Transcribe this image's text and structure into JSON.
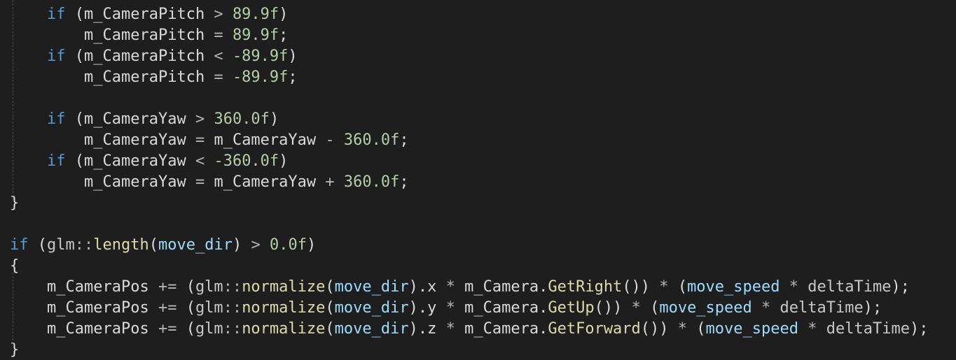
{
  "colors": {
    "background": "#1e1e1e",
    "keyword": "#569cd6",
    "member_variable": "#dadada",
    "number": "#b5cea8",
    "parameter": "#9cdcfe",
    "function": "#dcdcaa",
    "namespace": "#c8c8c8",
    "operator": "#b4b4b4",
    "punctuation": "#dcdcdc",
    "local_variable": "#c8c8c8",
    "indent_guide": "#4a4a4a"
  },
  "lines": [
    {
      "indent": 1,
      "tokens": [
        {
          "t": "if",
          "k": "keyword"
        },
        {
          "t": " (",
          "k": "punctuation"
        },
        {
          "t": "m_CameraPitch",
          "k": "member_variable"
        },
        {
          "t": " > ",
          "k": "operator"
        },
        {
          "t": "89.9f",
          "k": "number"
        },
        {
          "t": ")",
          "k": "punctuation"
        }
      ]
    },
    {
      "indent": 2,
      "tokens": [
        {
          "t": "m_CameraPitch",
          "k": "member_variable"
        },
        {
          "t": " = ",
          "k": "operator"
        },
        {
          "t": "89.9f",
          "k": "number"
        },
        {
          "t": ";",
          "k": "punctuation"
        }
      ]
    },
    {
      "indent": 1,
      "tokens": [
        {
          "t": "if",
          "k": "keyword"
        },
        {
          "t": " (",
          "k": "punctuation"
        },
        {
          "t": "m_CameraPitch",
          "k": "member_variable"
        },
        {
          "t": " < ",
          "k": "operator"
        },
        {
          "t": "-89.9f",
          "k": "number"
        },
        {
          "t": ")",
          "k": "punctuation"
        }
      ]
    },
    {
      "indent": 2,
      "tokens": [
        {
          "t": "m_CameraPitch",
          "k": "member_variable"
        },
        {
          "t": " = ",
          "k": "operator"
        },
        {
          "t": "-89.9f",
          "k": "number"
        },
        {
          "t": ";",
          "k": "punctuation"
        }
      ]
    },
    {
      "indent": 0,
      "tokens": []
    },
    {
      "indent": 1,
      "tokens": [
        {
          "t": "if",
          "k": "keyword"
        },
        {
          "t": " (",
          "k": "punctuation"
        },
        {
          "t": "m_CameraYaw",
          "k": "member_variable"
        },
        {
          "t": " > ",
          "k": "operator"
        },
        {
          "t": "360.0f",
          "k": "number"
        },
        {
          "t": ")",
          "k": "punctuation"
        }
      ]
    },
    {
      "indent": 2,
      "tokens": [
        {
          "t": "m_CameraYaw",
          "k": "member_variable"
        },
        {
          "t": " = ",
          "k": "operator"
        },
        {
          "t": "m_CameraYaw",
          "k": "member_variable"
        },
        {
          "t": " - ",
          "k": "operator"
        },
        {
          "t": "360.0f",
          "k": "number"
        },
        {
          "t": ";",
          "k": "punctuation"
        }
      ]
    },
    {
      "indent": 1,
      "tokens": [
        {
          "t": "if",
          "k": "keyword"
        },
        {
          "t": " (",
          "k": "punctuation"
        },
        {
          "t": "m_CameraYaw",
          "k": "member_variable"
        },
        {
          "t": " < ",
          "k": "operator"
        },
        {
          "t": "-360.0f",
          "k": "number"
        },
        {
          "t": ")",
          "k": "punctuation"
        }
      ]
    },
    {
      "indent": 2,
      "tokens": [
        {
          "t": "m_CameraYaw",
          "k": "member_variable"
        },
        {
          "t": " = ",
          "k": "operator"
        },
        {
          "t": "m_CameraYaw",
          "k": "member_variable"
        },
        {
          "t": " + ",
          "k": "operator"
        },
        {
          "t": "360.0f",
          "k": "number"
        },
        {
          "t": ";",
          "k": "punctuation"
        }
      ]
    },
    {
      "indent": 0,
      "tokens": [
        {
          "t": "}",
          "k": "punctuation"
        }
      ]
    },
    {
      "indent": 0,
      "tokens": []
    },
    {
      "indent": 0,
      "tokens": [
        {
          "t": "if",
          "k": "keyword"
        },
        {
          "t": " (",
          "k": "punctuation"
        },
        {
          "t": "glm",
          "k": "namespace"
        },
        {
          "t": "::",
          "k": "operator"
        },
        {
          "t": "length",
          "k": "function"
        },
        {
          "t": "(",
          "k": "punctuation"
        },
        {
          "t": "move_dir",
          "k": "parameter"
        },
        {
          "t": ")",
          "k": "punctuation"
        },
        {
          "t": " > ",
          "k": "operator"
        },
        {
          "t": "0.0f",
          "k": "number"
        },
        {
          "t": ")",
          "k": "punctuation"
        }
      ]
    },
    {
      "indent": 0,
      "tokens": [
        {
          "t": "{",
          "k": "punctuation"
        }
      ]
    },
    {
      "indent": 1,
      "tokens": [
        {
          "t": "m_CameraPos",
          "k": "member_variable"
        },
        {
          "t": " += ",
          "k": "operator"
        },
        {
          "t": "(",
          "k": "punctuation"
        },
        {
          "t": "glm",
          "k": "namespace"
        },
        {
          "t": "::",
          "k": "operator"
        },
        {
          "t": "normalize",
          "k": "function"
        },
        {
          "t": "(",
          "k": "punctuation"
        },
        {
          "t": "move_dir",
          "k": "parameter"
        },
        {
          "t": ").",
          "k": "punctuation"
        },
        {
          "t": "x",
          "k": "member_variable"
        },
        {
          "t": " * ",
          "k": "operator"
        },
        {
          "t": "m_Camera",
          "k": "member_variable"
        },
        {
          "t": ".",
          "k": "punctuation"
        },
        {
          "t": "GetRight",
          "k": "function"
        },
        {
          "t": "())",
          "k": "punctuation"
        },
        {
          "t": " * ",
          "k": "operator"
        },
        {
          "t": "(",
          "k": "punctuation"
        },
        {
          "t": "move_speed",
          "k": "parameter"
        },
        {
          "t": " * ",
          "k": "operator"
        },
        {
          "t": "deltaTime",
          "k": "local_variable"
        },
        {
          "t": ");",
          "k": "punctuation"
        }
      ]
    },
    {
      "indent": 1,
      "tokens": [
        {
          "t": "m_CameraPos",
          "k": "member_variable"
        },
        {
          "t": " += ",
          "k": "operator"
        },
        {
          "t": "(",
          "k": "punctuation"
        },
        {
          "t": "glm",
          "k": "namespace"
        },
        {
          "t": "::",
          "k": "operator"
        },
        {
          "t": "normalize",
          "k": "function"
        },
        {
          "t": "(",
          "k": "punctuation"
        },
        {
          "t": "move_dir",
          "k": "parameter"
        },
        {
          "t": ").",
          "k": "punctuation"
        },
        {
          "t": "y",
          "k": "member_variable"
        },
        {
          "t": " * ",
          "k": "operator"
        },
        {
          "t": "m_Camera",
          "k": "member_variable"
        },
        {
          "t": ".",
          "k": "punctuation"
        },
        {
          "t": "GetUp",
          "k": "function"
        },
        {
          "t": "())",
          "k": "punctuation"
        },
        {
          "t": " * ",
          "k": "operator"
        },
        {
          "t": "(",
          "k": "punctuation"
        },
        {
          "t": "move_speed",
          "k": "parameter"
        },
        {
          "t": " * ",
          "k": "operator"
        },
        {
          "t": "deltaTime",
          "k": "local_variable"
        },
        {
          "t": ");",
          "k": "punctuation"
        }
      ]
    },
    {
      "indent": 1,
      "tokens": [
        {
          "t": "m_CameraPos",
          "k": "member_variable"
        },
        {
          "t": " += ",
          "k": "operator"
        },
        {
          "t": "(",
          "k": "punctuation"
        },
        {
          "t": "glm",
          "k": "namespace"
        },
        {
          "t": "::",
          "k": "operator"
        },
        {
          "t": "normalize",
          "k": "function"
        },
        {
          "t": "(",
          "k": "punctuation"
        },
        {
          "t": "move_dir",
          "k": "parameter"
        },
        {
          "t": ").",
          "k": "punctuation"
        },
        {
          "t": "z",
          "k": "member_variable"
        },
        {
          "t": " * ",
          "k": "operator"
        },
        {
          "t": "m_Camera",
          "k": "member_variable"
        },
        {
          "t": ".",
          "k": "punctuation"
        },
        {
          "t": "GetForward",
          "k": "function"
        },
        {
          "t": "())",
          "k": "punctuation"
        },
        {
          "t": " * ",
          "k": "operator"
        },
        {
          "t": "(",
          "k": "punctuation"
        },
        {
          "t": "move_speed",
          "k": "parameter"
        },
        {
          "t": " * ",
          "k": "operator"
        },
        {
          "t": "deltaTime",
          "k": "local_variable"
        },
        {
          "t": ");",
          "k": "punctuation"
        }
      ]
    },
    {
      "indent": 0,
      "tokens": [
        {
          "t": "}",
          "k": "punctuation"
        }
      ]
    }
  ]
}
